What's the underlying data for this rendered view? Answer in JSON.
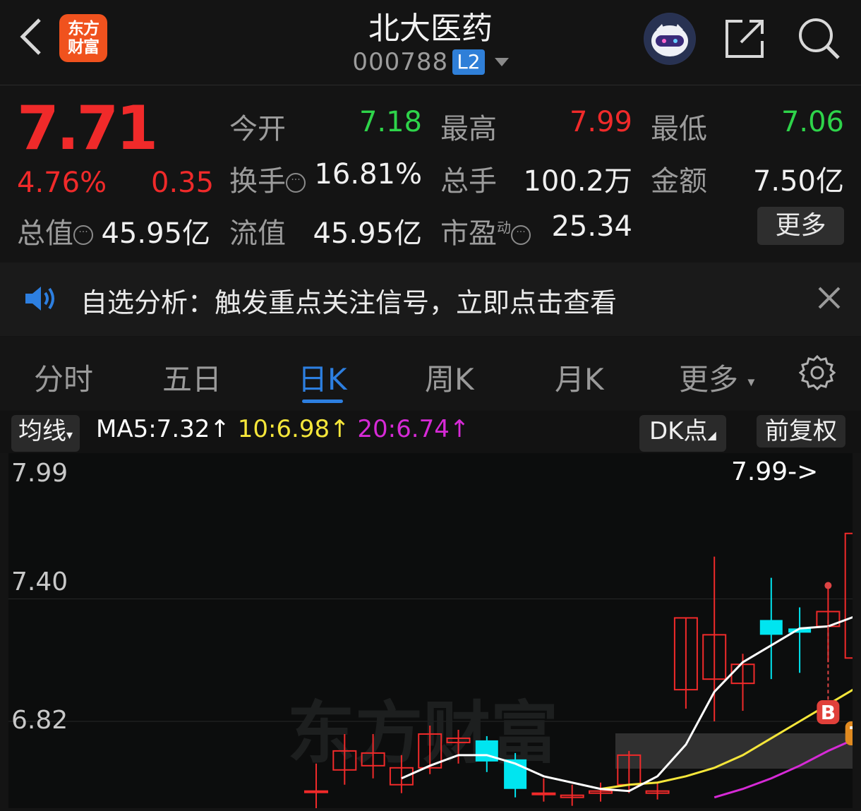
{
  "header": {
    "title": "北大医药",
    "code": "000788",
    "level_badge": "L2",
    "brand_line1": "东方",
    "brand_line2": "财富",
    "icons": [
      "back-arrow-icon",
      "robot-avatar-icon",
      "share-icon",
      "search-icon"
    ]
  },
  "quote": {
    "price": "7.71",
    "change_pct": "4.76%",
    "change": "0.35",
    "open_label": "今开",
    "open": "7.18",
    "high_label": "最高",
    "high": "7.99",
    "low_label": "最低",
    "low": "7.06",
    "turnover_label": "换手",
    "turnover": "16.81%",
    "volume_label": "总手",
    "volume": "100.2万",
    "amount_label": "金额",
    "amount": "7.50亿",
    "mcap_label": "总值",
    "mcap": "45.95亿",
    "float_label": "流值",
    "float_cap": "45.95亿",
    "pe_label": "市盈",
    "pe_super": "动",
    "pe": "25.34",
    "more": "更多",
    "info_glyph": "···"
  },
  "notice": {
    "text": "自选分析：触发重点关注信号，立即点击查看"
  },
  "tabs": [
    "分时",
    "五日",
    "日K",
    "周K",
    "月K",
    "更多"
  ],
  "active_tab": 2,
  "chart_header": {
    "ma_button": "均线",
    "ma5": "MA5:7.32↑",
    "ma10": "10:6.98↑",
    "ma20": "20:6.74↑",
    "dk_button": "DK点",
    "adjust_button": "前复权"
  },
  "colors": {
    "up": "#f02a2a",
    "down": "#00e5f0",
    "ma5": "#ffffff",
    "ma10": "#f5e63a",
    "ma20": "#d62ad6",
    "accent": "#2d7fe0"
  },
  "chart_data": {
    "type": "candlestick",
    "y_ticks": [
      "7.99",
      "7.40",
      "6.82"
    ],
    "max_marker": "7.99->",
    "watermark": "东方财富",
    "signals": [
      "B",
      "T"
    ],
    "candles": [
      {
        "open": 6.49,
        "close": 6.49,
        "high": 6.62,
        "low": 6.4,
        "dir": "up"
      },
      {
        "open": 6.59,
        "close": 6.68,
        "high": 6.76,
        "low": 6.52,
        "dir": "up"
      },
      {
        "open": 6.61,
        "close": 6.67,
        "high": 6.76,
        "low": 6.55,
        "dir": "up"
      },
      {
        "open": 6.52,
        "close": 6.6,
        "high": 6.66,
        "low": 6.48,
        "dir": "up"
      },
      {
        "open": 6.6,
        "close": 6.76,
        "high": 6.8,
        "low": 6.57,
        "dir": "up"
      },
      {
        "open": 6.72,
        "close": 6.74,
        "high": 6.78,
        "low": 6.62,
        "dir": "up"
      },
      {
        "open": 6.73,
        "close": 6.63,
        "high": 6.75,
        "low": 6.58,
        "dir": "down"
      },
      {
        "open": 6.64,
        "close": 6.5,
        "high": 6.67,
        "low": 6.46,
        "dir": "down"
      },
      {
        "open": 6.48,
        "close": 6.48,
        "high": 6.55,
        "low": 6.44,
        "dir": "up"
      },
      {
        "open": 6.46,
        "close": 6.47,
        "high": 6.52,
        "low": 6.42,
        "dir": "up"
      },
      {
        "open": 6.48,
        "close": 6.49,
        "high": 6.53,
        "low": 6.44,
        "dir": "up"
      },
      {
        "open": 6.52,
        "close": 6.66,
        "high": 6.68,
        "low": 6.48,
        "dir": "up"
      },
      {
        "open": 6.48,
        "close": 6.49,
        "high": 6.53,
        "low": 6.45,
        "dir": "up"
      },
      {
        "open": 6.97,
        "close": 7.31,
        "high": 7.31,
        "low": 6.88,
        "dir": "up"
      },
      {
        "open": 7.02,
        "close": 7.23,
        "high": 7.6,
        "low": 6.82,
        "dir": "up"
      },
      {
        "open": 7.0,
        "close": 7.09,
        "high": 7.14,
        "low": 6.87,
        "dir": "up"
      },
      {
        "open": 7.23,
        "close": 7.3,
        "high": 7.5,
        "low": 7.02,
        "dir": "down"
      },
      {
        "open": 7.24,
        "close": 7.26,
        "high": 7.36,
        "low": 7.05,
        "dir": "down"
      },
      {
        "open": 7.27,
        "close": 7.34,
        "high": 7.45,
        "low": 7.1,
        "dir": "up"
      },
      {
        "open": 7.12,
        "close": 7.71,
        "high": 7.99,
        "low": 7.06,
        "dir": "up"
      }
    ],
    "ma5": [
      6.55,
      6.61,
      6.66,
      6.66,
      6.62,
      6.56,
      6.53,
      6.5,
      6.49,
      6.56,
      6.71,
      6.96,
      7.1,
      7.18,
      7.26,
      7.27,
      7.32
    ],
    "ma10": [
      6.5,
      6.52,
      6.53,
      6.56,
      6.6,
      6.66,
      6.74,
      6.82,
      6.9,
      6.98
    ],
    "ma20": [
      6.46,
      6.5,
      6.55,
      6.61,
      6.68,
      6.74
    ]
  }
}
